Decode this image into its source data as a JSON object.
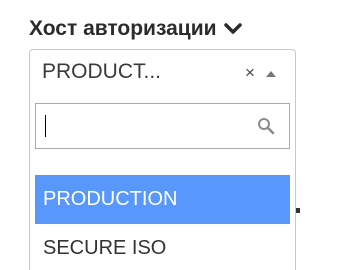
{
  "field": {
    "label": "Хост авторизации",
    "label_chevron_icon": "chevron-down-icon"
  },
  "select": {
    "value": "PRODUCT...",
    "clear_glyph": "×",
    "toggle_icon": "caret-up-icon"
  },
  "dropdown": {
    "search": {
      "value": "",
      "placeholder": "",
      "icon": "search-icon"
    },
    "options": [
      {
        "label": "PRODUCTION",
        "highlighted": true
      },
      {
        "label": "SECURE ISO",
        "highlighted": false
      }
    ]
  },
  "colors": {
    "highlight": "#5897fb",
    "border": "#c8c8c8",
    "text": "#333333"
  }
}
